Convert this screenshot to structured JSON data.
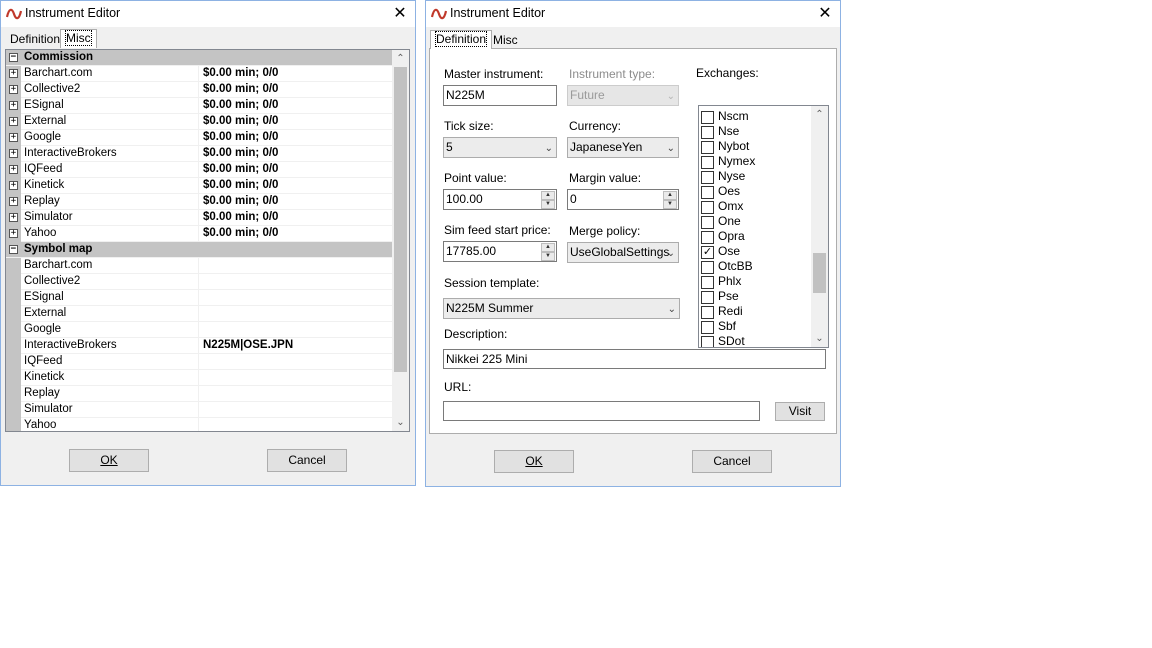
{
  "left_window": {
    "title": "Instrument Editor",
    "tabs": [
      "Definition",
      "Misc"
    ],
    "active_tab": "Misc",
    "sections": [
      {
        "category": "Commission",
        "rows": [
          {
            "name": "Barchart.com",
            "value": "$0.00 min;  0/0"
          },
          {
            "name": "Collective2",
            "value": "$0.00 min;  0/0"
          },
          {
            "name": "ESignal",
            "value": "$0.00 min;  0/0"
          },
          {
            "name": "External",
            "value": "$0.00 min;  0/0"
          },
          {
            "name": "Google",
            "value": "$0.00 min;  0/0"
          },
          {
            "name": "InteractiveBrokers",
            "value": "$0.00 min;  0/0"
          },
          {
            "name": "IQFeed",
            "value": "$0.00 min;  0/0"
          },
          {
            "name": "Kinetick",
            "value": "$0.00 min;  0/0"
          },
          {
            "name": "Replay",
            "value": "$0.00 min;  0/0"
          },
          {
            "name": "Simulator",
            "value": "$0.00 min;  0/0"
          },
          {
            "name": "Yahoo",
            "value": "$0.00 min;  0/0"
          }
        ]
      },
      {
        "category": "Symbol map",
        "rows": [
          {
            "name": "Barchart.com",
            "value": ""
          },
          {
            "name": "Collective2",
            "value": ""
          },
          {
            "name": "ESignal",
            "value": ""
          },
          {
            "name": "External",
            "value": ""
          },
          {
            "name": "Google",
            "value": ""
          },
          {
            "name": "InteractiveBrokers",
            "value": "N225M|OSE.JPN"
          },
          {
            "name": "IQFeed",
            "value": ""
          },
          {
            "name": "Kinetick",
            "value": ""
          },
          {
            "name": "Replay",
            "value": ""
          },
          {
            "name": "Simulator",
            "value": ""
          },
          {
            "name": "Yahoo",
            "value": ""
          }
        ]
      }
    ],
    "ok_label": "OK",
    "cancel_label": "Cancel"
  },
  "right_window": {
    "title": "Instrument Editor",
    "tabs": [
      "Definition",
      "Misc"
    ],
    "active_tab": "Definition",
    "master_instrument": {
      "label": "Master instrument:",
      "value": "N225M"
    },
    "instrument_type": {
      "label": "Instrument type:",
      "value": "Future"
    },
    "tick_size": {
      "label": "Tick size:",
      "value": "5"
    },
    "currency": {
      "label": "Currency:",
      "value": "JapaneseYen"
    },
    "point_value": {
      "label": "Point value:",
      "value": "100.00"
    },
    "margin_value": {
      "label": "Margin value:",
      "value": "0"
    },
    "sim_feed_start_price": {
      "label": "Sim feed start price:",
      "value": "17785.00"
    },
    "merge_policy": {
      "label": "Merge policy:",
      "value": "UseGlobalSettings"
    },
    "session_template": {
      "label": "Session template:",
      "value": "N225M Summer"
    },
    "description": {
      "label": "Description:",
      "value": "Nikkei 225 Mini"
    },
    "url": {
      "label": "URL:",
      "value": ""
    },
    "visit_label": "Visit",
    "exchanges": {
      "label": "Exchanges:",
      "items": [
        {
          "name": "Nscm",
          "checked": false
        },
        {
          "name": "Nse",
          "checked": false
        },
        {
          "name": "Nybot",
          "checked": false
        },
        {
          "name": "Nymex",
          "checked": false
        },
        {
          "name": "Nyse",
          "checked": false
        },
        {
          "name": "Oes",
          "checked": false
        },
        {
          "name": "Omx",
          "checked": false
        },
        {
          "name": "One",
          "checked": false
        },
        {
          "name": "Opra",
          "checked": false
        },
        {
          "name": "Ose",
          "checked": true
        },
        {
          "name": "OtcBB",
          "checked": false
        },
        {
          "name": "Phlx",
          "checked": false
        },
        {
          "name": "Pse",
          "checked": false
        },
        {
          "name": "Redi",
          "checked": false
        },
        {
          "name": "Sbf",
          "checked": false
        },
        {
          "name": "SDot",
          "checked": false
        }
      ]
    },
    "ok_label": "OK",
    "cancel_label": "Cancel"
  }
}
